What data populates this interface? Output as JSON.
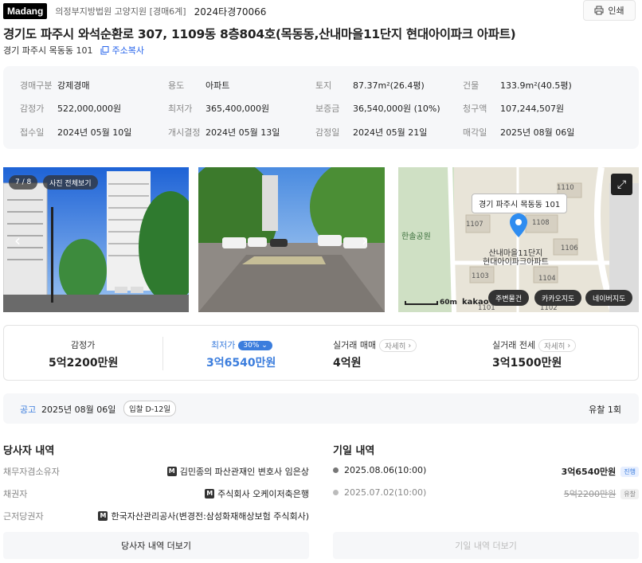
{
  "header": {
    "logo": "Madang",
    "court": "의정부지방법원 고양지원 [경매6계]",
    "case_no": "2024타경70066",
    "print_label": "인쇄"
  },
  "title": "경기도 파주시 와석순환로 307, 1109동 8층804호(목동동,산내마을11단지 현대아이파크 아파트)",
  "address": {
    "short": "경기 파주시 목동동 101",
    "copy_label": "주소복사"
  },
  "info": [
    {
      "label": "경매구분",
      "value": "강제경매"
    },
    {
      "label": "용도",
      "value": "아파트"
    },
    {
      "label": "토지",
      "value": "87.37m²(26.4평)"
    },
    {
      "label": "건물",
      "value": "133.9m²(40.5평)"
    },
    {
      "label": "감정가",
      "value": "522,000,000원"
    },
    {
      "label": "최저가",
      "value": "365,400,000원"
    },
    {
      "label": "보증금",
      "value": "36,540,000원 (10%)"
    },
    {
      "label": "청구액",
      "value": "107,244,507원"
    },
    {
      "label": "접수일",
      "value": "2024년 05월 10일"
    },
    {
      "label": "개시결정",
      "value": "2024년 05월 13일"
    },
    {
      "label": "감정일",
      "value": "2024년 05월 21일"
    },
    {
      "label": "매각일",
      "value": "2025년 08월 06일"
    }
  ],
  "photos": {
    "counter": "7 / 8",
    "all_label": "사진 전체보기"
  },
  "map": {
    "popup": "경기 파주시 목동동 101",
    "label_complex": "산내마을11단지\n현대아이파크아파트",
    "park": "한솔공원",
    "buildings": [
      "1110",
      "1107",
      "1108",
      "1106",
      "1103",
      "1104",
      "1101",
      "1102"
    ],
    "scale": "60m",
    "provider": "kakao",
    "buttons": [
      "주변물건",
      "카카오지도",
      "네이버지도"
    ]
  },
  "prices": [
    {
      "label": "감정가",
      "value": "5억2200만원"
    },
    {
      "label": "최저가",
      "badge": "30%",
      "value": "3억6540만원"
    },
    {
      "label": "실거래 매매",
      "chip": "자세히",
      "value": "4억원"
    },
    {
      "label": "실거래 전세",
      "chip": "자세히",
      "value": "3억1500만원"
    }
  ],
  "notice": {
    "label": "공고",
    "date": "2025년 08월 06일",
    "dday": "입찰 D-12일",
    "result": "유찰 1회"
  },
  "parties": {
    "title": "당사자 내역",
    "rows": [
      {
        "role": "채무자겸소유자",
        "name": "김민종의 파산관재인 변호사 임은상"
      },
      {
        "role": "채권자",
        "name": "주식회사 오케이저축은행"
      },
      {
        "role": "근저당권자",
        "name": "한국자산관리공사(변경전:삼성화재해상보험 주식회사)"
      }
    ],
    "more": "당사자 내역 더보기"
  },
  "dates": {
    "title": "기일 내역",
    "rows": [
      {
        "date": "2025.08.06(10:00)",
        "price": "3억6540만원",
        "status": "진행"
      },
      {
        "date": "2025.07.02(10:00)",
        "price": "5억2200만원",
        "status": "유찰"
      }
    ],
    "more": "기일 내역 더보기"
  },
  "colors": {
    "accent": "#3b7ddd",
    "map_pin": "#2e8cf0"
  }
}
